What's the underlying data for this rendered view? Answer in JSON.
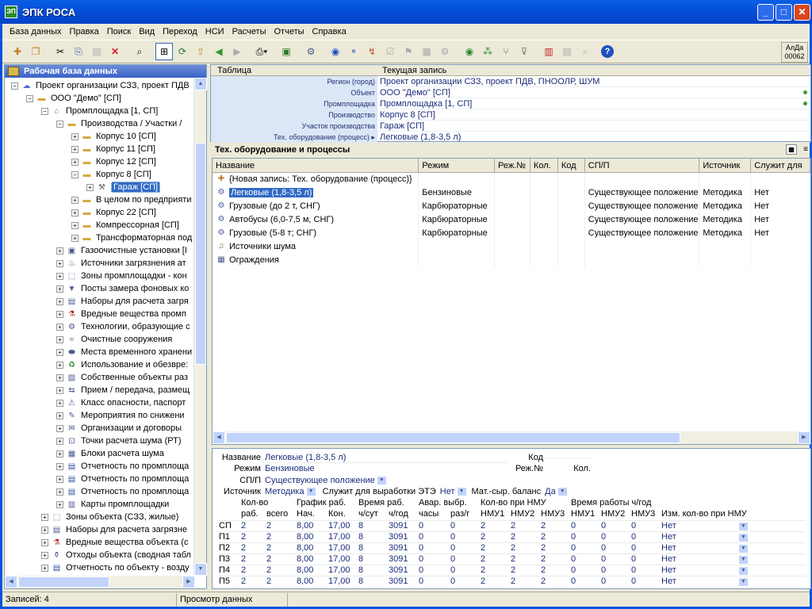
{
  "window": {
    "title": "ЭПК РОСА",
    "app_icon": "ЭП"
  },
  "menu": [
    "База данных",
    "Правка",
    "Поиск",
    "Вид",
    "Переход",
    "НСИ",
    "Расчеты",
    "Отчеты",
    "Справка"
  ],
  "toolbar_badge": {
    "line1": "АлДа",
    "line2": "00062"
  },
  "left_pane": {
    "title": "Рабочая база данных",
    "tree": [
      {
        "indent": 0,
        "pm": "−",
        "icon": "org-icon",
        "label": "Проект организации СЗЗ, проект ПДВ"
      },
      {
        "indent": 1,
        "pm": "−",
        "icon": "folder-icon",
        "label": "ООО \"Демо\" [СП]"
      },
      {
        "indent": 2,
        "pm": "−",
        "icon": "factory-icon",
        "label": "Промплощадка [1, СП]"
      },
      {
        "indent": 3,
        "pm": "−",
        "icon": "folder-icon",
        "label": "Производства / Участки /"
      },
      {
        "indent": 4,
        "pm": "+",
        "icon": "folder-icon",
        "label": "Корпус 10 [СП]"
      },
      {
        "indent": 4,
        "pm": "+",
        "icon": "folder-icon",
        "label": "Корпус 11 [СП]"
      },
      {
        "indent": 4,
        "pm": "+",
        "icon": "folder-icon",
        "label": "Корпус 12 [СП]"
      },
      {
        "indent": 4,
        "pm": "−",
        "icon": "folder-icon",
        "label": "Корпус 8 [СП]"
      },
      {
        "indent": 5,
        "pm": "+",
        "icon": "tools-icon",
        "label": "Гараж [СП]",
        "selected": true
      },
      {
        "indent": 4,
        "pm": "+",
        "icon": "folder-icon",
        "label": "В целом по предприяти"
      },
      {
        "indent": 4,
        "pm": "+",
        "icon": "folder-icon",
        "label": "Корпус 22 [СП]"
      },
      {
        "indent": 4,
        "pm": "+",
        "icon": "folder-icon",
        "label": "Компрессорная [СП]"
      },
      {
        "indent": 4,
        "pm": "+",
        "icon": "folder-icon",
        "label": "Трансформаторная под"
      },
      {
        "indent": 3,
        "pm": "+",
        "icon": "gas-cleaner-icon",
        "label": "Газоочистные установки [I"
      },
      {
        "indent": 3,
        "pm": "+",
        "icon": "pollution-source-icon",
        "label": "Источники загрязнения ат"
      },
      {
        "indent": 3,
        "pm": "+",
        "icon": "zone-icon",
        "label": "Зоны промплощадки - кон"
      },
      {
        "indent": 3,
        "pm": "+",
        "icon": "post-icon",
        "label": "Посты замера фоновых ко"
      },
      {
        "indent": 3,
        "pm": "+",
        "icon": "calc-set-icon",
        "label": "Наборы для расчета загря"
      },
      {
        "indent": 3,
        "pm": "+",
        "icon": "substance-icon",
        "label": "Вредные вещества промп"
      },
      {
        "indent": 3,
        "pm": "+",
        "icon": "tech-icon",
        "label": "Технологии, образующие с"
      },
      {
        "indent": 3,
        "pm": "+",
        "icon": "treatment-icon",
        "label": "Очистные сооружения"
      },
      {
        "indent": 3,
        "pm": "+",
        "icon": "storage-icon",
        "label": "Места временного хранени"
      },
      {
        "indent": 3,
        "pm": "+",
        "icon": "recycle-icon",
        "label": "Использование и обезвре:"
      },
      {
        "indent": 3,
        "pm": "+",
        "icon": "own-object-icon",
        "label": "Собственные объекты раз"
      },
      {
        "indent": 3,
        "pm": "+",
        "icon": "transfer-icon",
        "label": "Прием / передача, размещ"
      },
      {
        "indent": 3,
        "pm": "+",
        "icon": "hazard-class-icon",
        "label": "Класс опасности, паспорт"
      },
      {
        "indent": 3,
        "pm": "+",
        "icon": "measures-icon",
        "label": "Мероприятия по снижени"
      },
      {
        "indent": 3,
        "pm": "+",
        "icon": "contract-icon",
        "label": "Организации и договоры"
      },
      {
        "indent": 3,
        "pm": "+",
        "icon": "noise-point-icon",
        "label": "Точки расчета шума (РТ)"
      },
      {
        "indent": 3,
        "pm": "+",
        "icon": "noise-block-icon",
        "label": "Блоки расчета шума"
      },
      {
        "indent": 3,
        "pm": "+",
        "icon": "report-icon",
        "label": "Отчетность по промплоща"
      },
      {
        "indent": 3,
        "pm": "+",
        "icon": "report-icon",
        "label": "Отчетность по промплоща"
      },
      {
        "indent": 3,
        "pm": "+",
        "icon": "report-icon",
        "label": "Отчетность по промплоща"
      },
      {
        "indent": 3,
        "pm": "+",
        "icon": "map-icon",
        "label": "Карты промплощадки"
      },
      {
        "indent": 2,
        "pm": "+",
        "icon": "zone-icon",
        "label": "Зоны объекта (СЗЗ, жилые)"
      },
      {
        "indent": 2,
        "pm": "+",
        "icon": "calc-set-icon",
        "label": "Наборы для расчета загрязне"
      },
      {
        "indent": 2,
        "pm": "+",
        "icon": "substance-icon",
        "label": "Вредные вещества объекта (с"
      },
      {
        "indent": 2,
        "pm": "+",
        "icon": "waste-icon",
        "label": "Отходы объекта (сводная табл"
      },
      {
        "indent": 2,
        "pm": "+",
        "icon": "report-icon",
        "label": "Отчетность по объекту - возду"
      }
    ]
  },
  "record_header": {
    "col1": "Таблица",
    "col2": "Текущая запись"
  },
  "record_rows": [
    {
      "label": "Регион (город)",
      "value": "Проект организации СЗЗ, проект ПДВ, ПНООЛР, ШУМ",
      "dot": false
    },
    {
      "label": "Объект",
      "value": "ООО \"Демо\" [СП]",
      "dot": true
    },
    {
      "label": "Промплощадка",
      "value": "Промплощадка [1, СП]",
      "dot": true
    },
    {
      "label": "Производство",
      "value": "Корпус 8 [СП]",
      "dot": false
    },
    {
      "label": "Участок производства",
      "value": "Гараж [СП]",
      "dot": false
    },
    {
      "label": "Тех. оборудование (процесс) ▸",
      "value": "Легковые (1,8-3,5 л)",
      "dot": false
    }
  ],
  "section_title": "Тех. оборудование и процессы",
  "grid": {
    "columns": [
      "Название",
      "Режим",
      "Реж.№",
      "Кол.",
      "Код",
      "СП/П",
      "Источник",
      "Служит для"
    ],
    "rows": [
      {
        "icon": "new-record-icon",
        "name": "{Новая запись: Тех. оборудование (процесс)}",
        "mode": "",
        "modeno": "",
        "qty": "",
        "code": "",
        "sp": "",
        "source": "",
        "serves": ""
      },
      {
        "icon": "gear-icon",
        "name": "Легковые (1,8-3,5 л)",
        "mode": "Бензиновые",
        "modeno": "",
        "qty": "",
        "code": "",
        "sp": "Существующее положение",
        "source": "Методика",
        "serves": "Нет",
        "selected": true
      },
      {
        "icon": "gear-icon",
        "name": "Грузовые (до 2 т, СНГ)",
        "mode": "Карбюраторные",
        "modeno": "",
        "qty": "",
        "code": "",
        "sp": "Существующее положение",
        "source": "Методика",
        "serves": "Нет"
      },
      {
        "icon": "gear-icon",
        "name": "Автобусы (6,0-7,5 м, СНГ)",
        "mode": "Карбюраторные",
        "modeno": "",
        "qty": "",
        "code": "",
        "sp": "Существующее положение",
        "source": "Методика",
        "serves": "Нет"
      },
      {
        "icon": "gear-icon",
        "name": "Грузовые (5-8 т; СНГ)",
        "mode": "Карбюраторные",
        "modeno": "",
        "qty": "",
        "code": "",
        "sp": "Существующее положение",
        "source": "Методика",
        "serves": "Нет"
      },
      {
        "icon": "noise-source-icon",
        "name": "Источники шума",
        "mode": "",
        "modeno": "",
        "qty": "",
        "code": "",
        "sp": "",
        "source": "",
        "serves": ""
      },
      {
        "icon": "fence-icon",
        "name": "Ограждения",
        "mode": "",
        "modeno": "",
        "qty": "",
        "code": "",
        "sp": "",
        "source": "",
        "serves": ""
      }
    ]
  },
  "detail": {
    "name_label": "Название",
    "name_value": "Легковые (1,8-3,5 л)",
    "code_label": "Код",
    "code_value": "",
    "mode_label": "Режим",
    "mode_value": "Бензиновые",
    "modeno_label": "Реж.№",
    "modeno_value": "",
    "qty_label": "Кол.",
    "qty_value": "",
    "sp_label": "СП/П",
    "sp_value": "Существующее положение",
    "source_label": "Источник",
    "source_value": "Методика",
    "ete_label": "Служит для выработки ЭТЭ",
    "ete_value": "Нет",
    "balance_label": "Мат.-сыр. баланс",
    "balance_value": "Да",
    "head1": [
      "Кол-во",
      "График раб.",
      "Время раб.",
      "Авар. выбр.",
      "Кол-во при НМУ",
      "Время работы ч/год"
    ],
    "head2": [
      "раб.",
      "всего",
      "Нач.",
      "Кон.",
      "ч/сут",
      "ч/год",
      "часы",
      "раз/г",
      "НМУ1",
      "НМУ2",
      "НМУ3",
      "НМУ1",
      "НМУ2",
      "НМУ3",
      "Изм. кол-во при НМУ"
    ],
    "rows": [
      {
        "rn": "СП",
        "v": [
          "2",
          "2",
          "8,00",
          "17,00",
          "8",
          "3091",
          "0",
          "0",
          "2",
          "2",
          "2",
          "0",
          "0",
          "0",
          "Нет"
        ]
      },
      {
        "rn": "П1",
        "v": [
          "2",
          "2",
          "8,00",
          "17,00",
          "8",
          "3091",
          "0",
          "0",
          "2",
          "2",
          "2",
          "0",
          "0",
          "0",
          "Нет"
        ]
      },
      {
        "rn": "П2",
        "v": [
          "2",
          "2",
          "8,00",
          "17,00",
          "8",
          "3091",
          "0",
          "0",
          "2",
          "2",
          "2",
          "0",
          "0",
          "0",
          "Нет"
        ]
      },
      {
        "rn": "П3",
        "v": [
          "2",
          "2",
          "8,00",
          "17,00",
          "8",
          "3091",
          "0",
          "0",
          "2",
          "2",
          "2",
          "0",
          "0",
          "0",
          "Нет"
        ]
      },
      {
        "rn": "П4",
        "v": [
          "2",
          "2",
          "8,00",
          "17,00",
          "8",
          "3091",
          "0",
          "0",
          "2",
          "2",
          "2",
          "0",
          "0",
          "0",
          "Нет"
        ]
      },
      {
        "rn": "П5",
        "v": [
          "2",
          "2",
          "8,00",
          "17,00",
          "8",
          "3091",
          "0",
          "0",
          "2",
          "2",
          "2",
          "0",
          "0",
          "0",
          "Нет"
        ]
      }
    ]
  },
  "status": {
    "records": "Записей: 4",
    "mode": "Просмотр данных"
  }
}
